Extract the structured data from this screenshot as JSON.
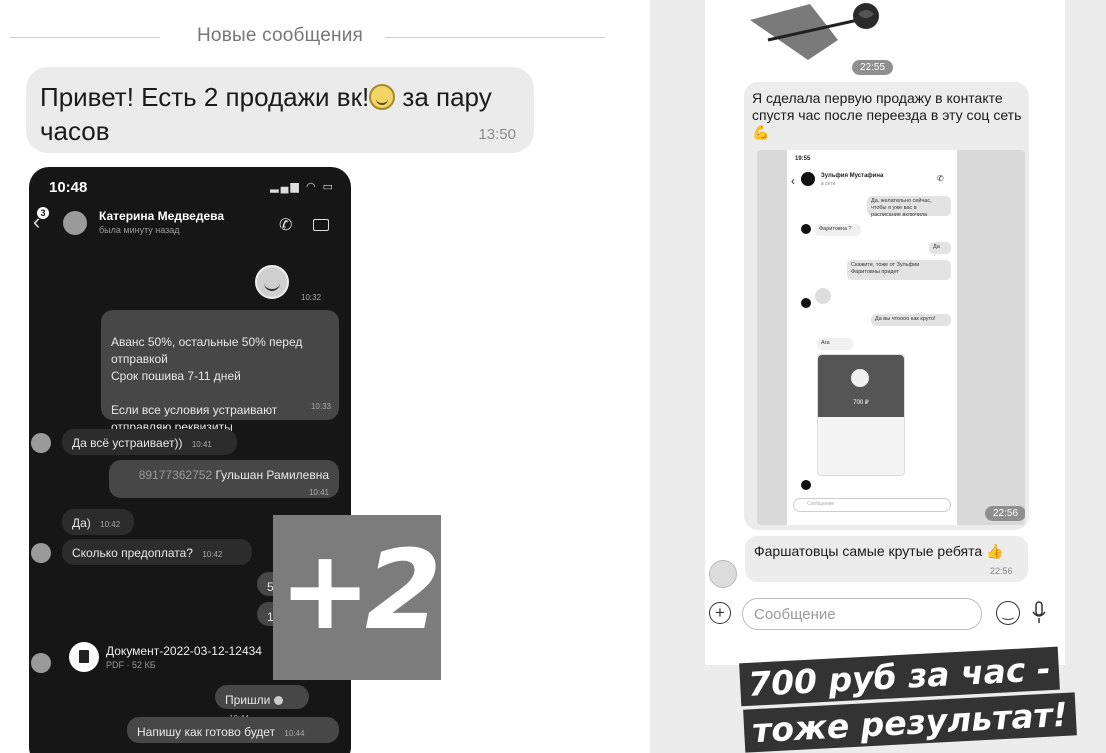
{
  "left": {
    "new_messages_divider": "Новые сообщения",
    "first_message": {
      "text_before": "Привет! Есть 2 продажи вк!",
      "text_after": " за пару часов",
      "time": "13:50"
    },
    "phone": {
      "status_time": "10:48",
      "unread_badge": "3",
      "contact_name": "Катерина Медведева",
      "contact_status": "была минуту назад",
      "messages": [
        {
          "id": "m1",
          "time": "10:32"
        },
        {
          "id": "m2",
          "text": "Аванс 50%, остальные 50% перед отправкой\nСрок пошива 7-11 дней\n\nЕсли все условия устраивают отправляю реквизиты",
          "time": "10:33"
        },
        {
          "id": "m3",
          "text": "Да всё устраивает))",
          "time": "10:41"
        },
        {
          "id": "m4",
          "phone": "89177362752",
          "name": "Гульшан Рамилевна",
          "time": "10:41"
        },
        {
          "id": "m5",
          "text": "Да)",
          "time": "10:42"
        },
        {
          "id": "m6",
          "text": "Сколько предоплата?",
          "time": "10:42"
        },
        {
          "id": "m7",
          "text": "5"
        },
        {
          "id": "m8",
          "text": "1"
        },
        {
          "id": "m9",
          "doc_name": "Документ-2022-03-12-12434",
          "doc_meta": "PDF · 52 КБ"
        },
        {
          "id": "m10",
          "text": "Пришли",
          "time": "10:44"
        },
        {
          "id": "m11",
          "text": "Напишу как готово будет",
          "time": "10:44"
        }
      ]
    },
    "overlay_label": "+2"
  },
  "right": {
    "rose_time": "22:55",
    "message1": "Я сделала первую продажу в контакте спустя час после переезда в эту соц сеть",
    "screenshot": {
      "status_time": "19:55",
      "contact_name": "Зульфия Мустафина",
      "contact_status": "в сети",
      "msgs": [
        "Да, желательно сейчас, чтобы я уже вас в расписание включила",
        "Фаритовна ?",
        "Да",
        "Скажите, тоже от Зульфии Фаритовны придет",
        "Да вы чтоооо как круто!",
        "Ага"
      ],
      "payment_amount": "700 ₽",
      "input_placeholder": "Сообщение",
      "time": "22:56"
    },
    "message2": "Фаршатовцы самые крутые ребята",
    "message2_time": "22:56",
    "input_placeholder": "Сообщение",
    "banner_line1": "700 руб за час -",
    "banner_line2": "тоже результат!"
  }
}
